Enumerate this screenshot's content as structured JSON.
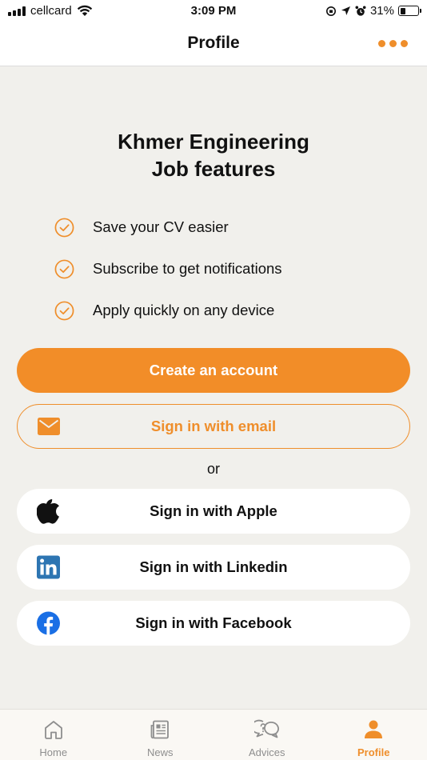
{
  "status_bar": {
    "carrier": "cellcard",
    "time": "3:09 PM",
    "battery": "31%",
    "battery_level": 0.31
  },
  "header": {
    "title": "Profile"
  },
  "features": {
    "title_line1": "Khmer Engineering",
    "title_line2": "Job features",
    "items": [
      "Save your CV easier",
      "Subscribe to get notifications",
      "Apply quickly on any device"
    ]
  },
  "actions": {
    "create_account": "Create an account",
    "sign_in_email": "Sign in with email",
    "or": "or",
    "sign_in_apple": "Sign in with Apple",
    "sign_in_linkedin": "Sign in with Linkedin",
    "sign_in_facebook": "Sign in with Facebook"
  },
  "tab_bar": {
    "tabs": [
      "Home",
      "News",
      "Advices",
      "Profile"
    ],
    "active": "Profile"
  },
  "colors": {
    "accent": "#ef8e2b",
    "background": "#f1f0ec",
    "linkedin": "#2d75b2",
    "facebook": "#1a6fe5"
  }
}
